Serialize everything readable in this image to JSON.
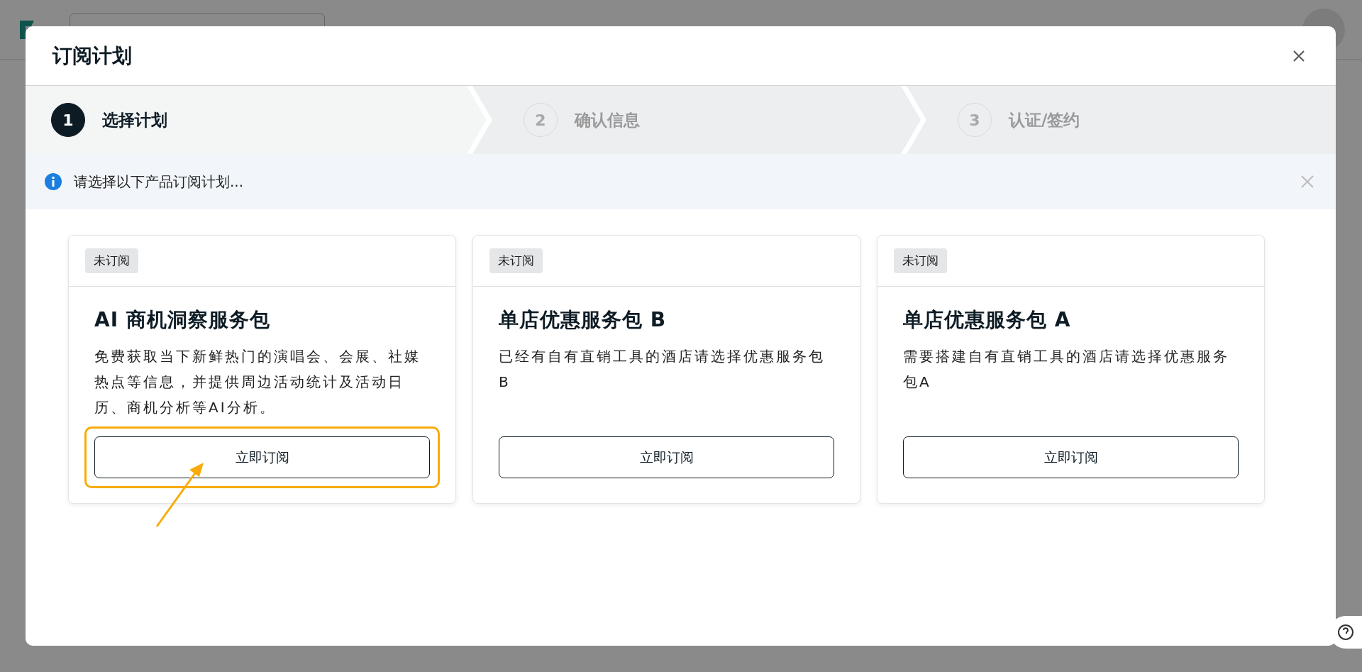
{
  "dialog": {
    "title": "订阅计划",
    "steps": [
      {
        "number": "1",
        "label": "选择计划",
        "selected": true
      },
      {
        "number": "2",
        "label": "确认信息",
        "selected": false
      },
      {
        "number": "3",
        "label": "认证/签约",
        "selected": false
      }
    ],
    "notice": {
      "text": "请选择以下产品订阅计划..."
    },
    "plans": [
      {
        "status": "未订阅",
        "title": "AI 商机洞察服务包",
        "description": "免费获取当下新鲜热门的演唱会、会展、社媒热点等信息，并提供周边活动统计及活动日历、商机分析等AI分析。",
        "action": "立即订阅",
        "highlighted": true
      },
      {
        "status": "未订阅",
        "title": "单店优惠服务包 B",
        "description": "已经有自有直销工具的酒店请选择优惠服务包B",
        "action": "立即订阅",
        "highlighted": false
      },
      {
        "status": "未订阅",
        "title": "单店优惠服务包 A",
        "description": "需要搭建自有直销工具的酒店请选择优惠服务包A",
        "action": "立即订阅",
        "highlighted": false
      }
    ]
  }
}
